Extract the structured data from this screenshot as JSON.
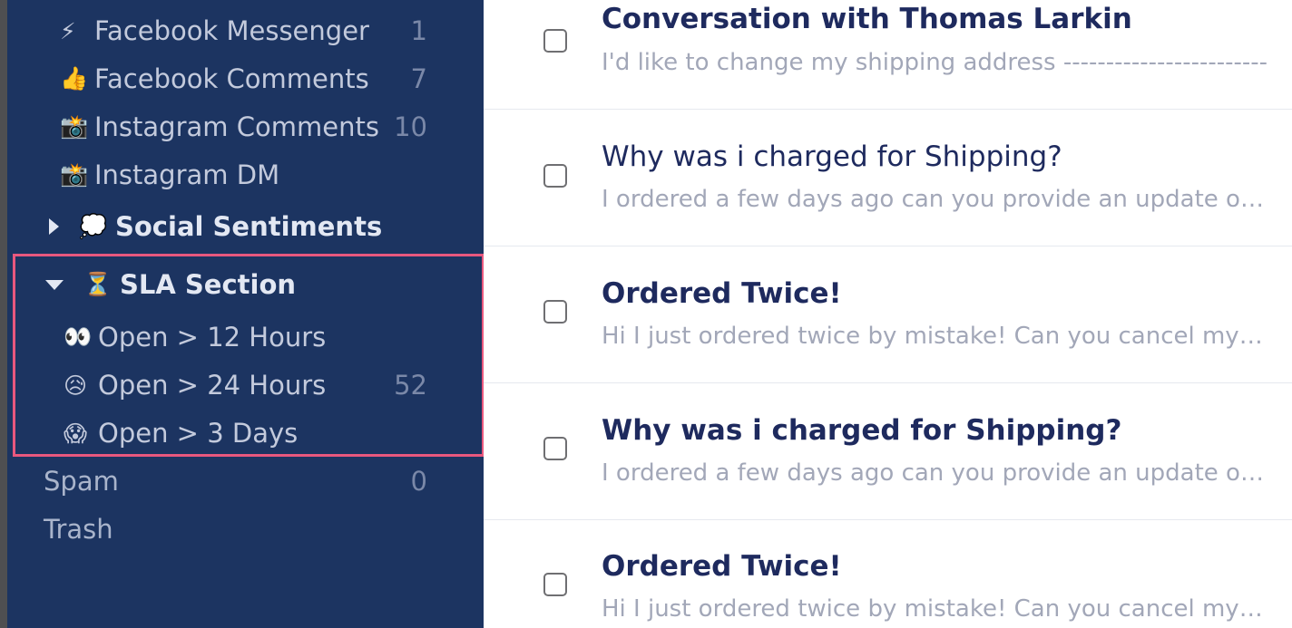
{
  "sidebar": {
    "channels": [
      {
        "emoji": "⚡",
        "icon": "lightning-icon",
        "label": "Facebook Messenger",
        "count": "1"
      },
      {
        "emoji": "👍",
        "icon": "thumbs-up-icon",
        "label": "Facebook Comments",
        "count": "7"
      },
      {
        "emoji": "📸",
        "icon": "camera-flash-icon",
        "label": "Instagram Comments",
        "count": "10"
      },
      {
        "emoji": "📸",
        "icon": "camera-flash-icon",
        "label": "Instagram DM",
        "count": ""
      }
    ],
    "social_sentiments": {
      "emoji": "💭",
      "icon": "thought-bubble-icon",
      "label": "Social Sentiments",
      "expanded": false
    },
    "sla_section": {
      "emoji": "⏳",
      "icon": "hourglass-icon",
      "label": "SLA Section",
      "expanded": true,
      "highlight_color": "#e8587e",
      "items": [
        {
          "emoji": "👀",
          "icon": "eyes-icon",
          "label": "Open > 12 Hours",
          "count": ""
        },
        {
          "emoji": "😥",
          "icon": "sad-face-icon",
          "label": "Open > 24 Hours",
          "count": "52"
        },
        {
          "emoji": "😱",
          "icon": "screaming-face-icon",
          "label": "Open > 3 Days",
          "count": ""
        }
      ]
    },
    "spam": {
      "label": "Spam",
      "count": "0"
    },
    "trash": {
      "label": "Trash"
    },
    "background_color": "#1c3461"
  },
  "conversations": [
    {
      "title": "Conversation with Thomas Larkin",
      "preview": "I'd like to change my shipping address ------------------------",
      "unread": true
    },
    {
      "title": "Why was i charged for Shipping?",
      "preview": "I ordered a few days ago can you provide an update on my order",
      "unread": false
    },
    {
      "title": "Ordered Twice!",
      "preview": "Hi I just ordered twice by mistake! Can you cancel my order please",
      "unread": true
    },
    {
      "title": "Why was i charged for Shipping?",
      "preview": "I ordered a few days ago can you provide an update on my order",
      "unread": true
    },
    {
      "title": "Ordered Twice!",
      "preview": "Hi I just ordered twice by mistake! Can you cancel my order please",
      "unread": true
    }
  ]
}
